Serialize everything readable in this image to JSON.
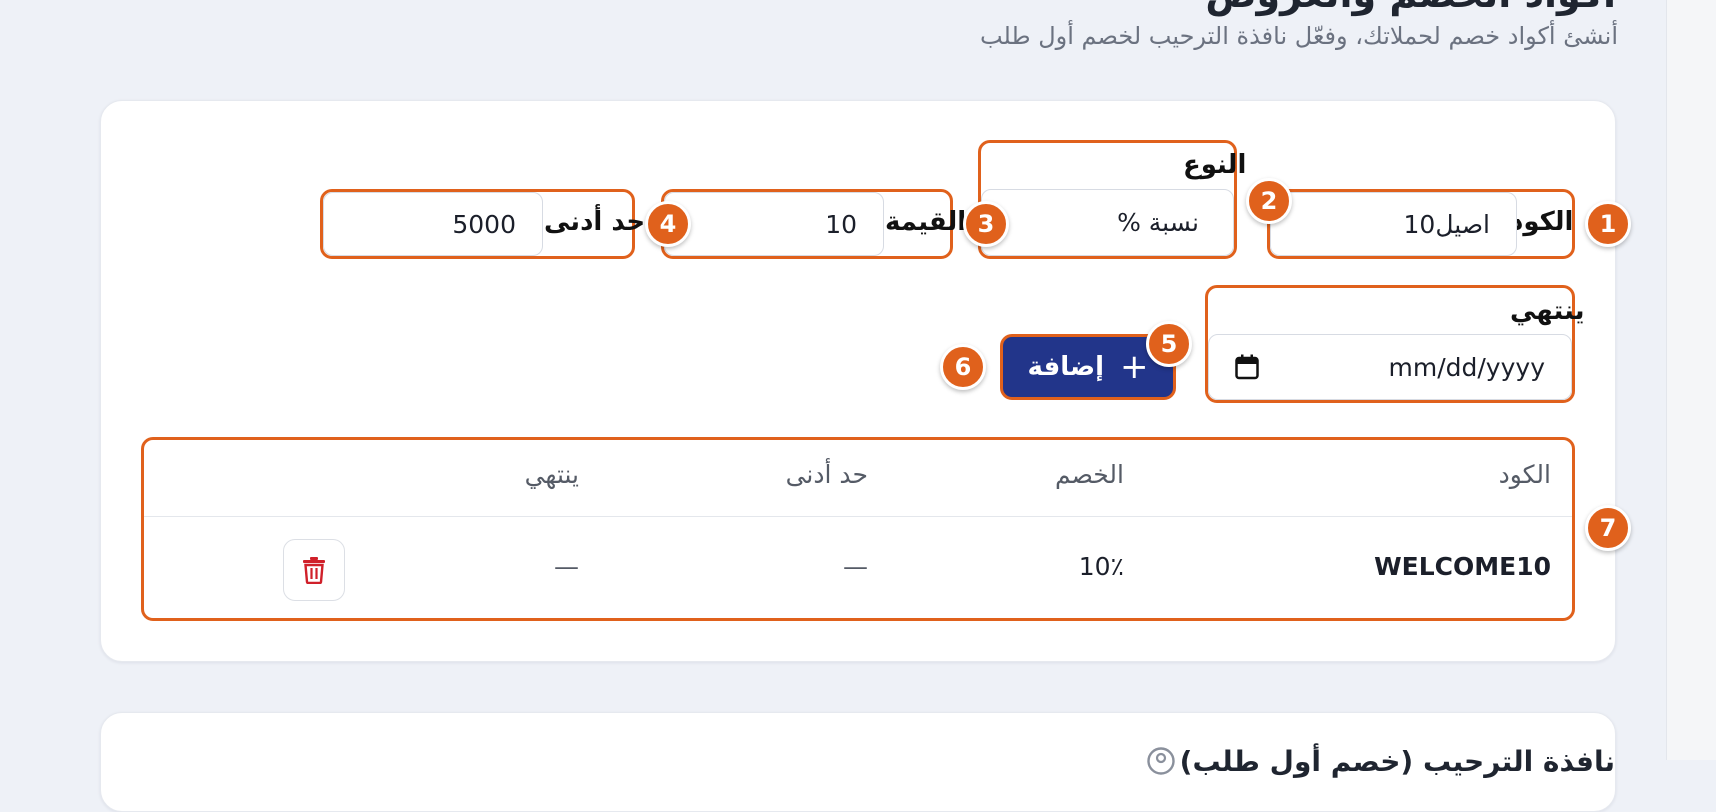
{
  "header": {
    "title": "أكواد الخصم والعروض",
    "subtitle": "أنشئ أكواد خصم لحملاتك، وفعّل نافذة الترحيب لخصم أول طلب"
  },
  "form": {
    "code_label": "الكود",
    "code_value": "اصيل10",
    "type_label": "النوع",
    "type_value": "نسبة %",
    "value_label": "القيمة",
    "value_value": "10",
    "min_label": "حد أدنى",
    "min_value": "5000",
    "expires_label": "ينتهي",
    "expires_placeholder": "mm/dd/yyyy",
    "add_label": "إضافة"
  },
  "table": {
    "columns": [
      "الكود",
      "الخصم",
      "حد أدنى",
      "ينتهي"
    ],
    "rows": [
      {
        "code": "WELCOME10",
        "discount": "10٪",
        "min": "—",
        "expires": "—"
      }
    ]
  },
  "next_section": {
    "title": "نافذة الترحيب (خصم أول طلب)"
  },
  "badges": [
    "1",
    "2",
    "3",
    "4",
    "5",
    "6",
    "7"
  ],
  "colors": {
    "accent": "#e0611c",
    "primary_button": "#22358a",
    "delete": "#d0202a",
    "background": "#eef1f7"
  }
}
